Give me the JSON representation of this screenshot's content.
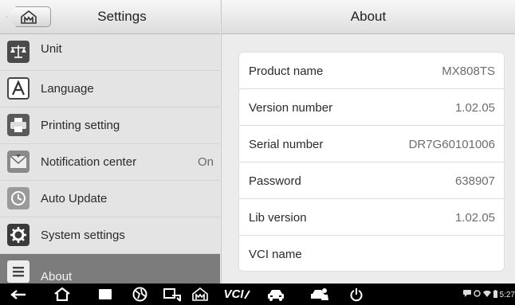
{
  "left_header": {
    "title": "Settings"
  },
  "right_header": {
    "title": "About"
  },
  "sidebar": {
    "items": [
      {
        "label": "Unit",
        "value": ""
      },
      {
        "label": "Language",
        "value": ""
      },
      {
        "label": "Printing setting",
        "value": ""
      },
      {
        "label": "Notification center",
        "value": "On"
      },
      {
        "label": "Auto Update",
        "value": ""
      },
      {
        "label": "System settings",
        "value": ""
      },
      {
        "label": "About",
        "value": ""
      }
    ]
  },
  "about": {
    "rows": [
      {
        "key": "Product name",
        "value": "MX808TS"
      },
      {
        "key": "Version number",
        "value": "1.02.05"
      },
      {
        "key": "Serial number",
        "value": "DR7G60101006"
      },
      {
        "key": "Password",
        "value": "638907"
      },
      {
        "key": "Lib version",
        "value": "1.02.05"
      },
      {
        "key": "VCI name",
        "value": ""
      }
    ]
  },
  "navbar": {
    "vci_label": "VCI",
    "clock": "5:27"
  }
}
